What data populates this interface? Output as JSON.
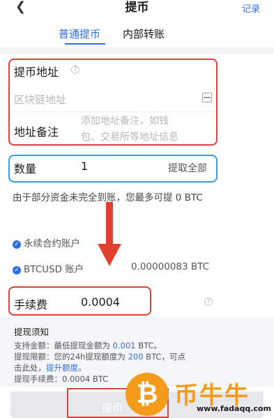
{
  "header": {
    "back_icon": "chevron-left-icon",
    "title": "提币",
    "record_label": "记录"
  },
  "tabs": [
    {
      "label": "普通提币",
      "active": true
    },
    {
      "label": "内部转账",
      "active": false
    }
  ],
  "address": {
    "label": "提币地址",
    "placeholder": "区块链地址",
    "scan_icon": "scan-icon",
    "info_icon": "info-icon"
  },
  "memo": {
    "label": "地址备注",
    "placeholder_line1": "添加地址备注，如钱",
    "placeholder_line2": "包、交易所等地址信息"
  },
  "quantity": {
    "label": "数量",
    "value": "1",
    "max_label": "提取全部"
  },
  "notice": "由于部分资金未完全到账，您最多可提 0 BTC",
  "accounts": [
    {
      "label": "永续合约账户",
      "value": ""
    },
    {
      "label": "BTCUSD 账户",
      "value": "0.00000083 BTC"
    }
  ],
  "fee": {
    "label": "手续费",
    "value": "0.0004",
    "info_icon": "info-icon"
  },
  "tips": {
    "title": "提现须知",
    "line1_prefix": "支持金额：最低提现金额为 ",
    "line1_value": "0.001",
    "line1_suffix": " BTC。",
    "line2_prefix": "提现限额：您的24h提现额度为 ",
    "line2_value": "200",
    "line2_suffix": " BTC，可点",
    "line3_prefix": "击此处，",
    "line3_link": "提升额度",
    "line3_suffix": "。",
    "line4": "提现手续费：0.0004 BTC"
  },
  "submit_label": "提币",
  "watermark": {
    "symbol": "₿",
    "brand": "币牛牛",
    "url": "www.fadaqq.com"
  },
  "colors": {
    "accent": "#2f6fe4",
    "highlight_red": "#d9433b",
    "highlight_blue": "#3a9ee3",
    "watermark_orange": "#f59b1b"
  }
}
